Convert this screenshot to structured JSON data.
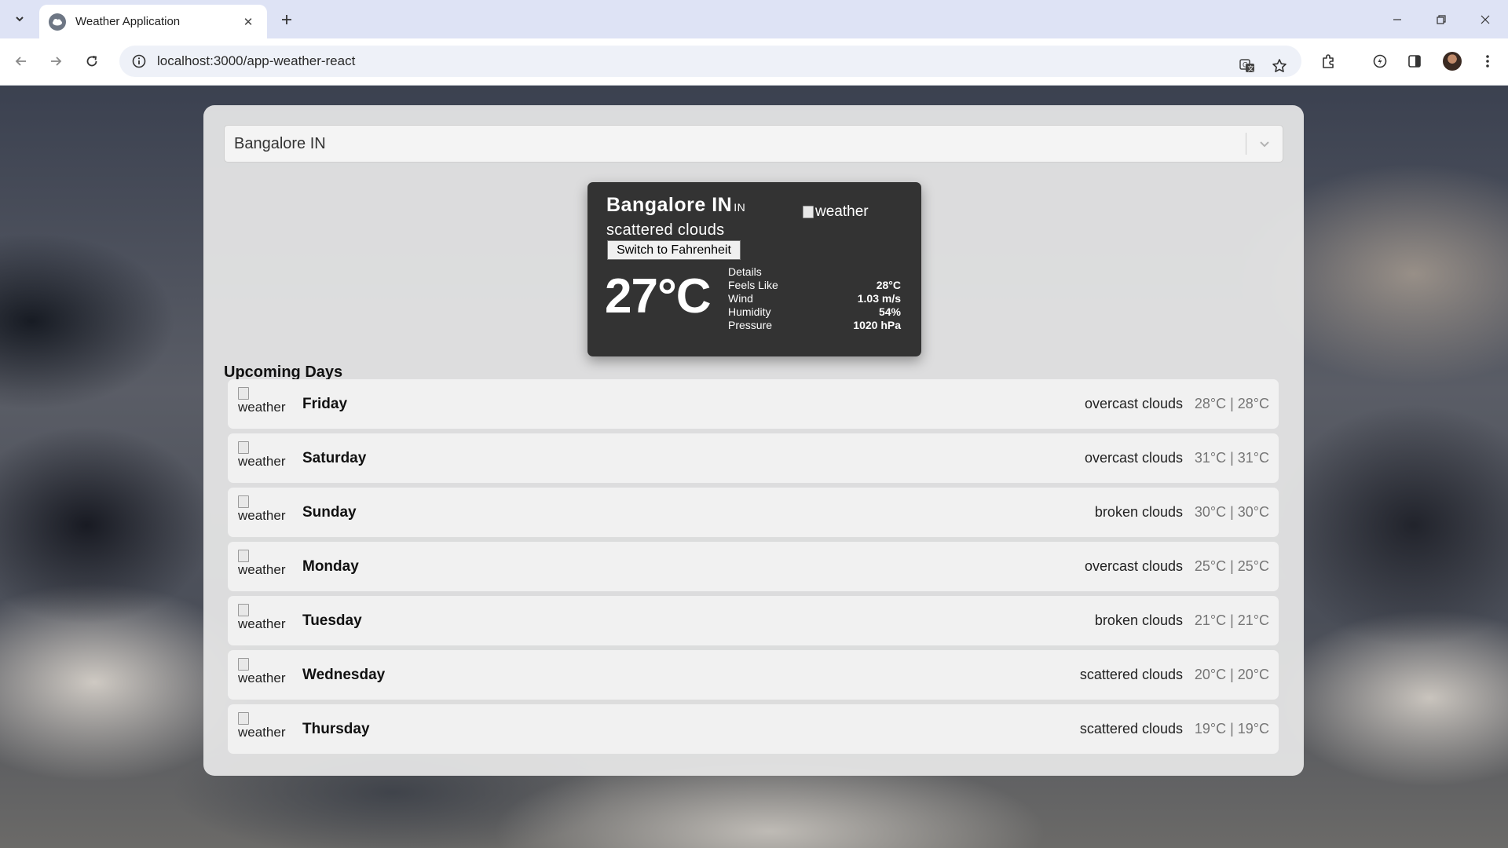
{
  "browser": {
    "tab_title": "Weather Application",
    "url": "localhost:3000/app-weather-react"
  },
  "search": {
    "value": "Bangalore IN"
  },
  "current": {
    "city": "Bangalore IN",
    "country": "IN",
    "description": "scattered clouds",
    "icon_alt": "weather",
    "unit_button": "Switch to Fahrenheit",
    "temperature": "27°C",
    "details_title": "Details",
    "details": [
      {
        "label": "Feels Like",
        "value": "28°C"
      },
      {
        "label": "Wind",
        "value": "1.03 m/s"
      },
      {
        "label": "Humidity",
        "value": "54%"
      },
      {
        "label": "Pressure",
        "value": "1020 hPa"
      }
    ]
  },
  "upcoming": {
    "title": "Upcoming Days",
    "days": [
      {
        "icon_alt": "weather",
        "name": "Friday",
        "description": "overcast clouds",
        "temps": "28°C | 28°C"
      },
      {
        "icon_alt": "weather",
        "name": "Saturday",
        "description": "overcast clouds",
        "temps": "31°C | 31°C"
      },
      {
        "icon_alt": "weather",
        "name": "Sunday",
        "description": "broken clouds",
        "temps": "30°C | 30°C"
      },
      {
        "icon_alt": "weather",
        "name": "Monday",
        "description": "overcast clouds",
        "temps": "25°C | 25°C"
      },
      {
        "icon_alt": "weather",
        "name": "Tuesday",
        "description": "broken clouds",
        "temps": "21°C | 21°C"
      },
      {
        "icon_alt": "weather",
        "name": "Wednesday",
        "description": "scattered clouds",
        "temps": "20°C | 20°C"
      },
      {
        "icon_alt": "weather",
        "name": "Thursday",
        "description": "scattered clouds",
        "temps": "19°C | 19°C"
      }
    ]
  }
}
